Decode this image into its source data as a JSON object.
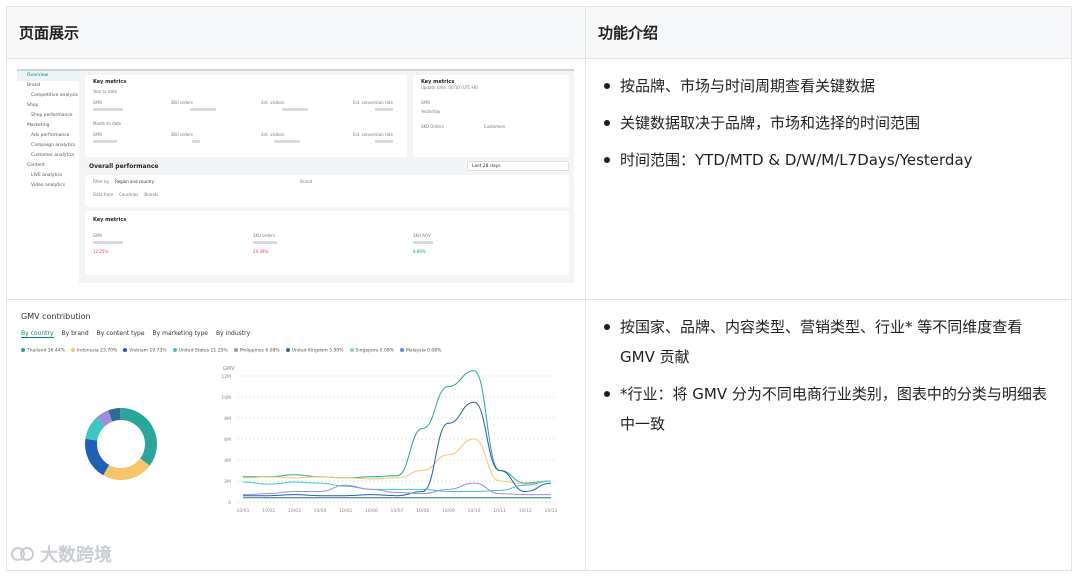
{
  "table": {
    "col_left_header": "页面展示",
    "col_right_header": "功能介绍"
  },
  "row1": {
    "bullets": [
      "按品牌、市场与时间周期查看关键数据",
      "关键数据取决于品牌，市场和选择的时间范围",
      "时间范围：YTD/MTD & D/W/M/L7Days/Yesterday"
    ],
    "screenshot": {
      "sidebar": [
        "Overview",
        "Brand",
        "Competitive analysis",
        "Shop",
        "Shop performance",
        "Marketing",
        "Ads performance",
        "Campaign analytics",
        "Customer analytics",
        "Content",
        "LIVE analytics",
        "Video analytics"
      ],
      "key_metrics_title": "Key metrics",
      "year_to_date": "Year to date",
      "month_to_date": "Month to date",
      "metric_labels": [
        "GMV",
        "SKU orders",
        "Est. visitors",
        "Est. conversion rate"
      ],
      "right_title": "Key metrics",
      "right_subtitle": "Update time: 00:10 (UTC+8)",
      "right_labels": [
        "GMV",
        "Yesterday",
        "SKU Orders",
        "Customers"
      ],
      "overall_title": "Overall performance",
      "date_range": "Last 28 days",
      "filter_label": "Filter by",
      "filter_value": "Region and country",
      "brand_label": "Brand",
      "data_from": "Data from",
      "data_from_options": [
        "Countries",
        "Brands"
      ],
      "key_metrics_2": "Key metrics",
      "km2_labels": [
        "GMV",
        "SKU orders",
        "SKU AOV"
      ],
      "km2_changes": [
        "12.25%",
        "24.39%",
        "8.89%"
      ]
    }
  },
  "row2": {
    "bullets": [
      "按国家、品牌、内容类型、营销类型、行业* 等不同维度查看 GMV 贡献",
      "*行业：将 GMV 分为不同电商行业类别，图表中的分类与明细表中一致"
    ],
    "screenshot": {
      "title": "GMV contribution",
      "tabs": [
        "By country",
        "By brand",
        "By content type",
        "By marketing type",
        "By industry"
      ],
      "legend": [
        {
          "name": "Thailand",
          "value": "36.44%",
          "color": "#2aa59a"
        },
        {
          "name": "Indonesia",
          "value": "23.70%",
          "color": "#f5c56b"
        },
        {
          "name": "Vietnam",
          "value": "19.73%",
          "color": "#1f5fb5"
        },
        {
          "name": "United States",
          "value": "11.25%",
          "color": "#3ec7c2"
        },
        {
          "name": "Philippines",
          "value": "6.08%",
          "color": "#9c8fe0"
        },
        {
          "name": "United Kingdom",
          "value": "5.90%",
          "color": "#2c6e8f"
        },
        {
          "name": "Singapore",
          "value": "0.08%",
          "color": "#7fd3c8"
        },
        {
          "name": "Malaysia",
          "value": "0.08%",
          "color": "#5a8de0"
        }
      ],
      "y_axis_label": "GMV",
      "y_ticks": [
        "12M",
        "10M",
        "8M",
        "6M",
        "4M",
        "2M",
        "0"
      ],
      "x_ticks": [
        "10/01",
        "10/02",
        "10/03",
        "10/04",
        "10/05",
        "10/06",
        "10/07",
        "10/08",
        "10/09",
        "10/10",
        "10/11",
        "10/12",
        "10/13"
      ]
    },
    "chart_data": {
      "type": "line",
      "x": [
        "10/01",
        "10/02",
        "10/03",
        "10/04",
        "10/05",
        "10/06",
        "10/07",
        "10/08",
        "10/09",
        "10/10",
        "10/11",
        "10/12",
        "10/13"
      ],
      "ylim": [
        0,
        12
      ],
      "series": [
        {
          "name": "Thailand",
          "values": [
            2.4,
            2.4,
            2.6,
            2.4,
            2.3,
            2.4,
            2.5,
            7.0,
            11.0,
            12.5,
            3.0,
            1.8,
            2.0
          ]
        },
        {
          "name": "Indonesia",
          "values": [
            2.3,
            2.4,
            2.3,
            2.4,
            2.3,
            2.2,
            2.3,
            3.0,
            4.5,
            6.0,
            2.0,
            1.7,
            2.0
          ]
        },
        {
          "name": "Vietnam",
          "values": [
            0.6,
            0.6,
            0.7,
            0.6,
            0.6,
            0.7,
            0.6,
            1.0,
            7.5,
            9.5,
            3.0,
            1.0,
            1.8
          ]
        },
        {
          "name": "United States",
          "values": [
            1.9,
            1.7,
            1.9,
            1.8,
            1.5,
            1.2,
            1.2,
            1.2,
            1.0,
            1.0,
            1.1,
            1.6,
            2.0
          ]
        },
        {
          "name": "Philippines",
          "values": [
            0.7,
            0.8,
            1.0,
            1.0,
            1.6,
            1.2,
            0.9,
            0.8,
            1.2,
            1.8,
            0.8,
            0.7,
            0.7
          ]
        },
        {
          "name": "United Kingdom",
          "values": [
            0.4,
            0.4,
            0.4,
            0.4,
            0.4,
            0.4,
            0.4,
            0.4,
            0.4,
            0.4,
            0.4,
            0.4,
            0.4
          ]
        }
      ]
    },
    "donut_data": {
      "type": "pie",
      "values": [
        36.44,
        23.7,
        19.73,
        11.25,
        6.08,
        5.9,
        0.08,
        0.08
      ]
    }
  },
  "watermark": "大数跨境"
}
